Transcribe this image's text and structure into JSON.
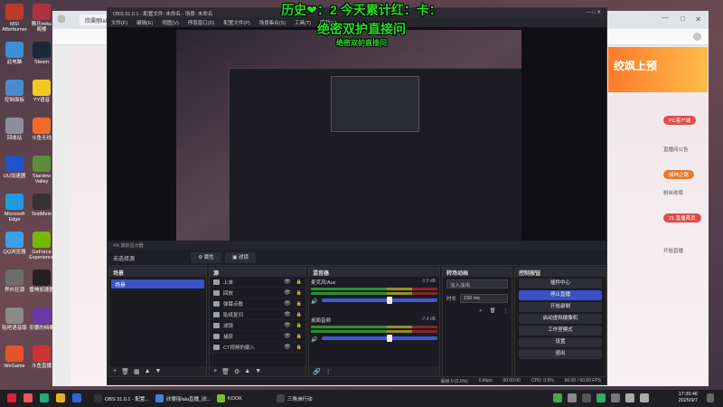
{
  "desktop": {
    "icons_left": [
      {
        "label": "MSI\nAfterburner",
        "color": "#c0392b"
      },
      {
        "label": "此电脑",
        "color": "#3d8fd6"
      },
      {
        "label": "控制面板",
        "color": "#4a8bd0"
      },
      {
        "label": "回收站",
        "color": "#8a9099"
      },
      {
        "label": "UU加速器",
        "color": "#2253c9"
      },
      {
        "label": "Microsoft\nEdge",
        "color": "#1f9be0"
      },
      {
        "label": "QQ浏览器",
        "color": "#3aa0e8"
      },
      {
        "label": "界外狂潮",
        "color": "#6d6d6d"
      },
      {
        "label": "贴吧语音版",
        "color": "#8a8a8a"
      },
      {
        "label": "WeGame",
        "color": "#e4532b"
      }
    ],
    "icons_right": [
      {
        "label": "雅乐miku\n阁楼",
        "color": "#b03040"
      },
      {
        "label": "Steam",
        "color": "#1b2838"
      },
      {
        "label": "YY语音",
        "color": "#f2c81f"
      },
      {
        "label": "斗鱼无线",
        "color": "#f16a2a"
      },
      {
        "label": "Stardew\nValley",
        "color": "#5e8d3a"
      },
      {
        "label": "TestMem",
        "color": "#333"
      },
      {
        "label": "GeForce\nExperience",
        "color": "#76b900"
      },
      {
        "label": "雷神加速器",
        "color": "#222"
      },
      {
        "label": "安娜的档案",
        "color": "#6b3aa8"
      },
      {
        "label": "斗鱼直播",
        "color": "#c33"
      }
    ]
  },
  "browser": {
    "tab_title": "欣渠丽lala直播间",
    "banner_text": "绞飒上预",
    "sidebar_pills": [
      {
        "text": "PC客户端",
        "color": "#e34a4a"
      },
      {
        "text": "成神之路",
        "color": "#e67b2f"
      },
      {
        "text": "21 直播首页",
        "color": "#e34a4a"
      }
    ],
    "side_text": "直播间公告",
    "side_text2": "粉丝勋章",
    "side_text3": "开始直播"
  },
  "overlay": {
    "line1": "历史❤：2 今天累计红：卡：",
    "line2": "绝密双护直接问",
    "line3": "绝密双护直接问"
  },
  "obs": {
    "title": "OBS 31.0.1 - 配置文件: 未命名 - 场景: 未命名",
    "menu": [
      "文件(F)",
      "编辑(E)",
      "视图(V)",
      "停靠窗口(D)",
      "配置文件(P)",
      "场景集合(S)",
      "工具(T)",
      "帮助(H)"
    ],
    "ribbon": "4% 捕获显示器",
    "no_source": "未选择源",
    "properties_btn": "⚙ 属性",
    "filters_btn": "▣ 滤镜",
    "scenes": {
      "header": "场景",
      "items": [
        "场景"
      ]
    },
    "sources": {
      "header": "源",
      "items": [
        {
          "name": "上单",
          "color": "#9aa0a6"
        },
        {
          "name": "回放",
          "color": "#9aa0a6"
        },
        {
          "name": "弹幕点歌",
          "color": "#9aa0a6"
        },
        {
          "name": "贴纸复归",
          "color": "#9aa0a6"
        },
        {
          "name": "滤镜",
          "color": "#9aa0a6"
        },
        {
          "name": "捕获",
          "color": "#9aa0a6"
        },
        {
          "name": "CT视频的摄入",
          "color": "#9aa0a6"
        }
      ]
    },
    "mixer": {
      "header": "混音器",
      "channels": [
        {
          "name": "麦克风/Aux",
          "db": "0.0 dB",
          "level": 0.56
        },
        {
          "name": "桌面音频",
          "db": "-7.4 dB",
          "level": 0.56
        }
      ]
    },
    "transitions": {
      "header": "转场动画",
      "type": "淡入淡出",
      "duration_label": "时长",
      "duration": "150 ms"
    },
    "controls": {
      "header": "控制按钮",
      "buttons": [
        "插件中心",
        "停止直播",
        "开始录制",
        "启动虚拟摄像机",
        "工作室模式",
        "设置",
        "退出"
      ],
      "active_index": 1
    },
    "status": {
      "dropped": "丢帧 0 (0.0%)",
      "bitrate": "0 kbps",
      "time": "00:00:00",
      "cpu": "CPU: 0.5%",
      "fps": "60.00 / 60.00 FPS"
    }
  },
  "taskbar": {
    "apps": [
      {
        "label": "OBS 31.0.1 - 配置...",
        "color": "#333"
      },
      {
        "label": "欣渠丽lala直播_欣...",
        "color": "#3a84d8"
      },
      {
        "label": "KOOK",
        "color": "#78c02a"
      },
      {
        "label": "三角洲行动",
        "color": "#444"
      }
    ],
    "time": "17:39:46",
    "date": "2025/9/7"
  }
}
